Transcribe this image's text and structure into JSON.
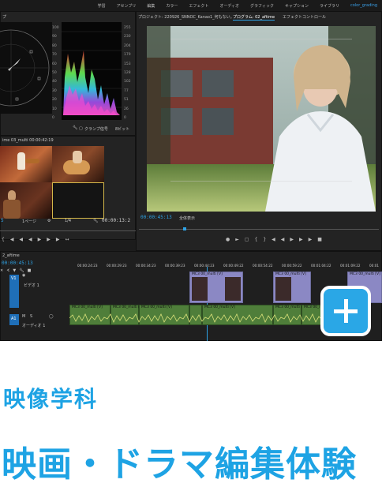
{
  "menu": {
    "items": [
      "学習",
      "アセンブリ",
      "編集",
      "カラー",
      "エフェクト",
      "オーディオ",
      "グラフィック",
      "キャプション",
      "ライブラリ"
    ],
    "active_workspace": "color_grading"
  },
  "scopes": {
    "panel_title": "プ",
    "scale_left": [
      "100",
      "90",
      "80",
      "70",
      "60",
      "50",
      "40",
      "30",
      "20",
      "10",
      "0"
    ],
    "scale_right": [
      "255",
      "230",
      "204",
      "179",
      "153",
      "128",
      "102",
      "77",
      "51",
      "26",
      "0"
    ],
    "clamp_label": "クランプ信号",
    "bit_label": "8ビット"
  },
  "source_monitor": {
    "title": "ime 03_multi 00:00:42:19",
    "timecode_left": "5",
    "page_label": "1ページ",
    "zoom": "1/4",
    "timecode_right": "00:00:13:2"
  },
  "program_monitor": {
    "tabs": [
      "プロジェクト: 220926_SNNOC_Kanao1_何もない。",
      "プログラム: 02_aftime",
      "エフェクトコントロール"
    ],
    "timecode": "00:00:45:13",
    "fit_label": "全体表示"
  },
  "timeline": {
    "sequence_name": "2_aftime",
    "timecode": "00:00:45:13",
    "ruler": [
      "00:00:24:23",
      "00:00:29:23",
      "00:00:34:23",
      "00:00:39:23",
      "00:00:44:23",
      "00:00:49:22",
      "00:00:54:22",
      "00:00:59:22",
      "00:01:04:22",
      "00:01:09:22",
      "00:01"
    ],
    "tracks": {
      "v1_label": "V1",
      "v1_name": "ビデオ 1",
      "a1_label": "A1",
      "a1_name": "オーディオ 1"
    },
    "clip_labels": [
      "MC3 00_multi [V]",
      "MC3 00_multi [V]",
      "MC3 00_multi [V]",
      "MC3 00_multi [V]",
      "MC3 00_multi [V]",
      "MC3 00_multi [V]"
    ],
    "video_clip_labels": [
      "MC3 00_multi [V]",
      "MC3 00_multi [V]",
      "MC3 00_multi [V]"
    ]
  },
  "overlay": {
    "plus_icon": "plus-icon",
    "department": "映像学科",
    "headline": "映画・ドラマ編集体験"
  },
  "colors": {
    "accent": "#1ea3e4",
    "timecode": "#2ea3e6",
    "audio_clip": "#4f7e3a",
    "video_clip": "#8b88c4"
  }
}
